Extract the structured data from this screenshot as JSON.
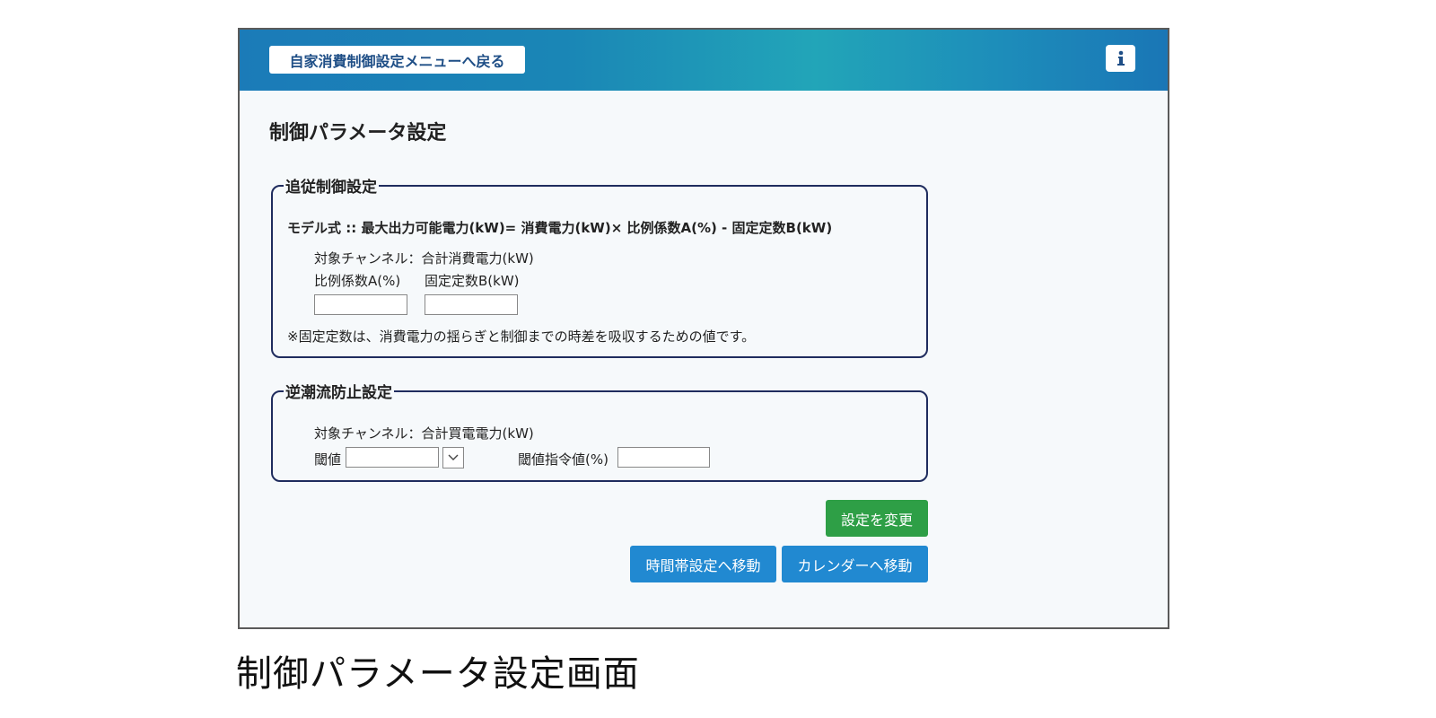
{
  "header": {
    "back_label": "自家消費制御設定メニューへ戻る",
    "info_icon": "info-icon"
  },
  "page_title": "制御パラメータ設定",
  "follow_control": {
    "legend": "追従制御設定",
    "formula": "モデル式 :: 最大出力可能電力(kW)= 消費電力(kW)× 比例係数A(%) - 固定定数B(kW)",
    "channel": "対象チャンネル：合計消費電力(kW)",
    "coef_a_label": "比例係数A(%)",
    "const_b_label": "固定定数B(kW)",
    "coef_a_value": "",
    "const_b_value": "",
    "note": "※固定定数は、消費電力の揺らぎと制御までの時差を吸収するための値です。"
  },
  "reverse_flow": {
    "legend": "逆潮流防止設定",
    "channel": "対象チャンネル：合計買電電力(kW)",
    "threshold_label": "閾値",
    "threshold_value": "",
    "threshold_cmd_label": "閾値指令値(%)",
    "threshold_cmd_value": ""
  },
  "buttons": {
    "apply": "設定を変更",
    "to_timezone": "時間帯設定へ移動",
    "to_calendar": "カレンダーへ移動"
  },
  "colors": {
    "header_blue": "#1b7bb8",
    "button_green": "#2e9f46",
    "button_blue": "#2189d1",
    "frame_navy": "#1f2c5e"
  },
  "caption": "制御パラメータ設定画面"
}
